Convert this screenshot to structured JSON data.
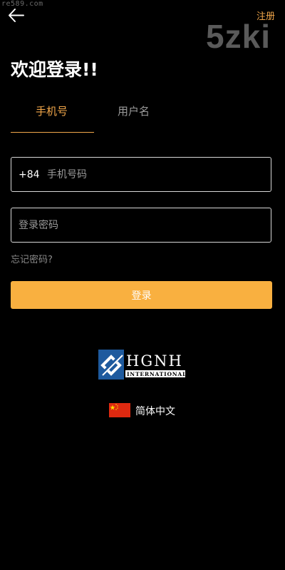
{
  "watermark_top": "re589.com",
  "watermark_brand": "5zki",
  "header": {
    "register_label": "注册",
    "back_icon": "arrow-left-icon"
  },
  "title": "欢迎登录!!",
  "tabs": [
    {
      "label": "手机号",
      "active": true
    },
    {
      "label": "用户名",
      "active": false
    }
  ],
  "form": {
    "country_code": "+84",
    "phone_placeholder": "手机号码",
    "password_placeholder": "登录密码",
    "forgot_label": "忘记密码?",
    "login_label": "登录"
  },
  "logo": {
    "main": "HGNH",
    "sub": "INTERNATIONAL"
  },
  "language": {
    "label": "简体中文",
    "flag_icon": "china-flag-icon"
  },
  "colors": {
    "accent": "#f2a74a",
    "button": "#f9b040",
    "background": "#000000"
  }
}
